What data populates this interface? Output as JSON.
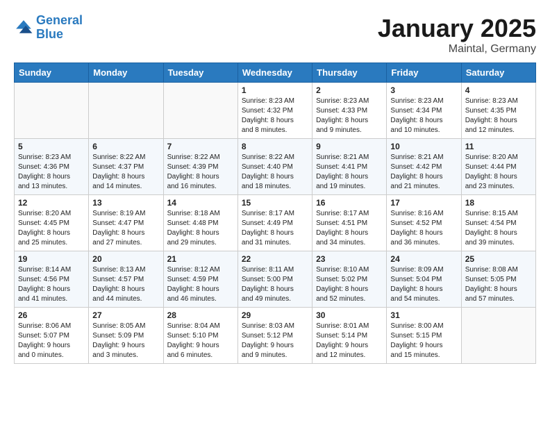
{
  "header": {
    "logo_line1": "General",
    "logo_line2": "Blue",
    "title": "January 2025",
    "subtitle": "Maintal, Germany"
  },
  "columns": [
    "Sunday",
    "Monday",
    "Tuesday",
    "Wednesday",
    "Thursday",
    "Friday",
    "Saturday"
  ],
  "weeks": [
    [
      {
        "day": "",
        "info": ""
      },
      {
        "day": "",
        "info": ""
      },
      {
        "day": "",
        "info": ""
      },
      {
        "day": "1",
        "info": "Sunrise: 8:23 AM\nSunset: 4:32 PM\nDaylight: 8 hours\nand 8 minutes."
      },
      {
        "day": "2",
        "info": "Sunrise: 8:23 AM\nSunset: 4:33 PM\nDaylight: 8 hours\nand 9 minutes."
      },
      {
        "day": "3",
        "info": "Sunrise: 8:23 AM\nSunset: 4:34 PM\nDaylight: 8 hours\nand 10 minutes."
      },
      {
        "day": "4",
        "info": "Sunrise: 8:23 AM\nSunset: 4:35 PM\nDaylight: 8 hours\nand 12 minutes."
      }
    ],
    [
      {
        "day": "5",
        "info": "Sunrise: 8:23 AM\nSunset: 4:36 PM\nDaylight: 8 hours\nand 13 minutes."
      },
      {
        "day": "6",
        "info": "Sunrise: 8:22 AM\nSunset: 4:37 PM\nDaylight: 8 hours\nand 14 minutes."
      },
      {
        "day": "7",
        "info": "Sunrise: 8:22 AM\nSunset: 4:39 PM\nDaylight: 8 hours\nand 16 minutes."
      },
      {
        "day": "8",
        "info": "Sunrise: 8:22 AM\nSunset: 4:40 PM\nDaylight: 8 hours\nand 18 minutes."
      },
      {
        "day": "9",
        "info": "Sunrise: 8:21 AM\nSunset: 4:41 PM\nDaylight: 8 hours\nand 19 minutes."
      },
      {
        "day": "10",
        "info": "Sunrise: 8:21 AM\nSunset: 4:42 PM\nDaylight: 8 hours\nand 21 minutes."
      },
      {
        "day": "11",
        "info": "Sunrise: 8:20 AM\nSunset: 4:44 PM\nDaylight: 8 hours\nand 23 minutes."
      }
    ],
    [
      {
        "day": "12",
        "info": "Sunrise: 8:20 AM\nSunset: 4:45 PM\nDaylight: 8 hours\nand 25 minutes."
      },
      {
        "day": "13",
        "info": "Sunrise: 8:19 AM\nSunset: 4:47 PM\nDaylight: 8 hours\nand 27 minutes."
      },
      {
        "day": "14",
        "info": "Sunrise: 8:18 AM\nSunset: 4:48 PM\nDaylight: 8 hours\nand 29 minutes."
      },
      {
        "day": "15",
        "info": "Sunrise: 8:17 AM\nSunset: 4:49 PM\nDaylight: 8 hours\nand 31 minutes."
      },
      {
        "day": "16",
        "info": "Sunrise: 8:17 AM\nSunset: 4:51 PM\nDaylight: 8 hours\nand 34 minutes."
      },
      {
        "day": "17",
        "info": "Sunrise: 8:16 AM\nSunset: 4:52 PM\nDaylight: 8 hours\nand 36 minutes."
      },
      {
        "day": "18",
        "info": "Sunrise: 8:15 AM\nSunset: 4:54 PM\nDaylight: 8 hours\nand 39 minutes."
      }
    ],
    [
      {
        "day": "19",
        "info": "Sunrise: 8:14 AM\nSunset: 4:56 PM\nDaylight: 8 hours\nand 41 minutes."
      },
      {
        "day": "20",
        "info": "Sunrise: 8:13 AM\nSunset: 4:57 PM\nDaylight: 8 hours\nand 44 minutes."
      },
      {
        "day": "21",
        "info": "Sunrise: 8:12 AM\nSunset: 4:59 PM\nDaylight: 8 hours\nand 46 minutes."
      },
      {
        "day": "22",
        "info": "Sunrise: 8:11 AM\nSunset: 5:00 PM\nDaylight: 8 hours\nand 49 minutes."
      },
      {
        "day": "23",
        "info": "Sunrise: 8:10 AM\nSunset: 5:02 PM\nDaylight: 8 hours\nand 52 minutes."
      },
      {
        "day": "24",
        "info": "Sunrise: 8:09 AM\nSunset: 5:04 PM\nDaylight: 8 hours\nand 54 minutes."
      },
      {
        "day": "25",
        "info": "Sunrise: 8:08 AM\nSunset: 5:05 PM\nDaylight: 8 hours\nand 57 minutes."
      }
    ],
    [
      {
        "day": "26",
        "info": "Sunrise: 8:06 AM\nSunset: 5:07 PM\nDaylight: 9 hours\nand 0 minutes."
      },
      {
        "day": "27",
        "info": "Sunrise: 8:05 AM\nSunset: 5:09 PM\nDaylight: 9 hours\nand 3 minutes."
      },
      {
        "day": "28",
        "info": "Sunrise: 8:04 AM\nSunset: 5:10 PM\nDaylight: 9 hours\nand 6 minutes."
      },
      {
        "day": "29",
        "info": "Sunrise: 8:03 AM\nSunset: 5:12 PM\nDaylight: 9 hours\nand 9 minutes."
      },
      {
        "day": "30",
        "info": "Sunrise: 8:01 AM\nSunset: 5:14 PM\nDaylight: 9 hours\nand 12 minutes."
      },
      {
        "day": "31",
        "info": "Sunrise: 8:00 AM\nSunset: 5:15 PM\nDaylight: 9 hours\nand 15 minutes."
      },
      {
        "day": "",
        "info": ""
      }
    ]
  ]
}
